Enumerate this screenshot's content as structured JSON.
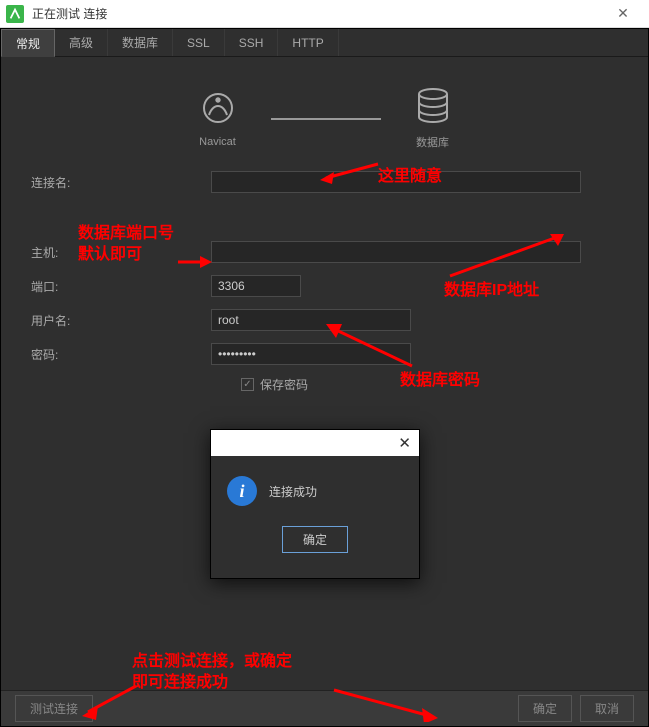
{
  "window": {
    "title": "正在测试            连接"
  },
  "tabs": [
    "常规",
    "高级",
    "数据库",
    "SSL",
    "SSH",
    "HTTP"
  ],
  "diagram": {
    "left_label": "Navicat",
    "right_label": "数据库"
  },
  "form": {
    "connection_name_label": "连接名:",
    "connection_name_value": "",
    "host_label": "主机:",
    "host_value": "",
    "port_label": "端口:",
    "port_value": "3306",
    "username_label": "用户名:",
    "username_value": "root",
    "password_label": "密码:",
    "password_value": "•••••••••",
    "save_password_label": "保存密码"
  },
  "popup": {
    "message": "连接成功",
    "ok_label": "确定"
  },
  "bottom": {
    "test_label": "测试连接",
    "ok_label": "确定",
    "cancel_label": "取消"
  },
  "annotations": {
    "a1": "这里随意",
    "a2_line1": "数据库端口号",
    "a2_line2": "默认即可",
    "a3": "数据库IP地址",
    "a4": "数据库密码",
    "a5_line1": "点击测试连接，或确定",
    "a5_line2": "即可连接成功"
  }
}
